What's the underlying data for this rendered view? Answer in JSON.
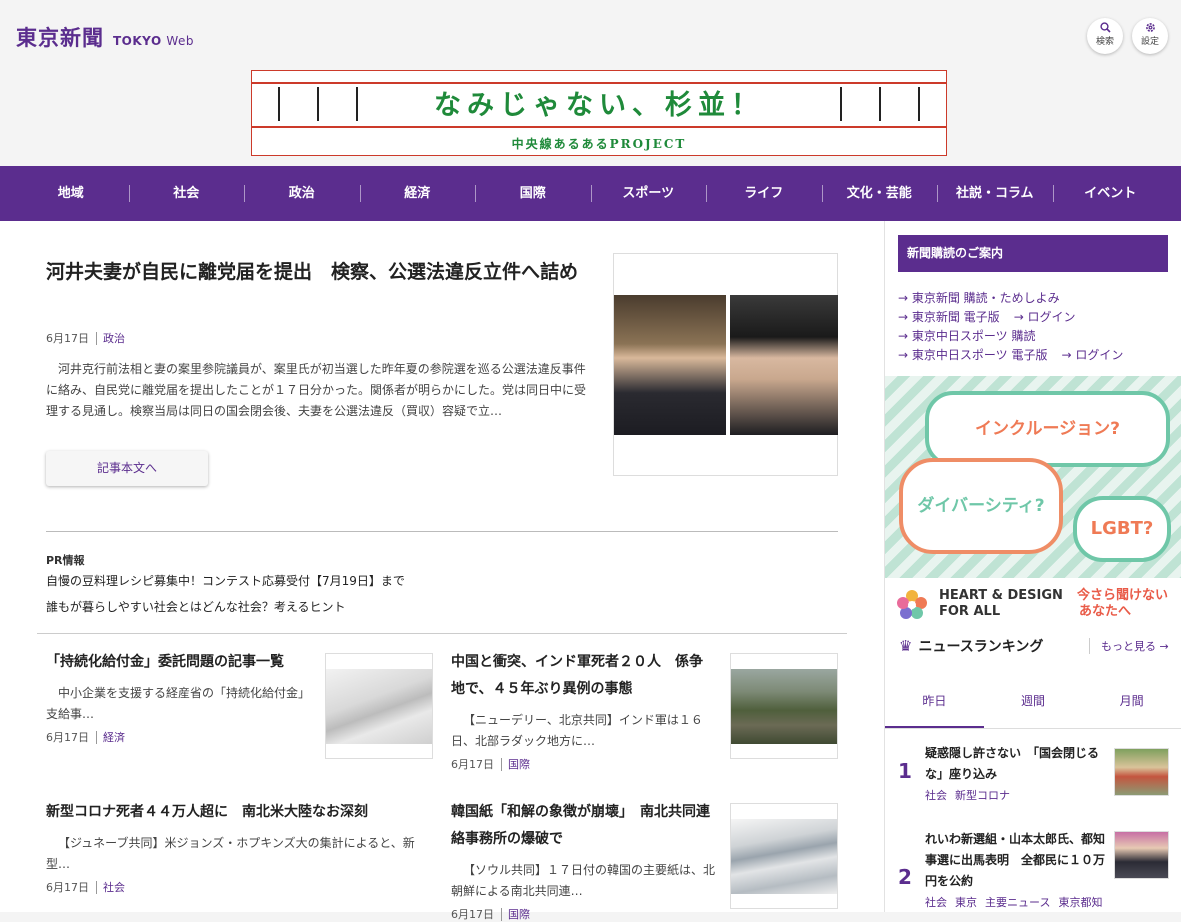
{
  "header": {
    "logo_jp": "東京新聞",
    "logo_en_bold": "TOKYO",
    "logo_en": "Web",
    "search_label": "検索",
    "settings_label": "設定"
  },
  "banner": {
    "title": "なみじゃない、杉並！",
    "subtitle": "中央線あるあるPROJECT"
  },
  "nav": [
    "地域",
    "社会",
    "政治",
    "経済",
    "国際",
    "スポーツ",
    "ライフ",
    "文化・芸能",
    "社説・コラム",
    "イベント"
  ],
  "lead": {
    "title": "河井夫妻が自民に離党届を提出　検察、公選法違反立件へ詰め",
    "date": "6月17日",
    "category": "政治",
    "body": "河井克行前法相と妻の案里参院議員が、案里氏が初当選した昨年夏の参院選を巡る公選法違反事件に絡み、自民党に離党届を提出したことが１７日分かった。関係者が明らかにした。党は同日中に受理する見通し。検察当局は同日の国会閉会後、夫妻を公選法違反（買収）容疑で立…",
    "button": "記事本文へ"
  },
  "pr": {
    "heading": "PR情報",
    "links": [
      "自慢の豆料理レシピ募集中！コンテスト応募受付【7月19日】まで",
      "誰もが暮らしやすい社会とはどんな社会？考えるヒント"
    ]
  },
  "cards": [
    {
      "title": "「持続化給付金」委託問題の記事一覧",
      "body": "中小企業を支援する経産省の「持続化給付金」支給事…",
      "date": "6月17日",
      "category": "経済"
    },
    {
      "title": "中国と衝突、インド軍死者２０人　係争地で、４５年ぶり異例の事態",
      "body": "【ニューデリー、北京共同】インド軍は１６日、北部ラダック地方に…",
      "date": "6月17日",
      "category": "国際"
    },
    {
      "title": "新型コロナ死者４４万人超に　南北米大陸なお深刻",
      "body": "【ジュネーブ共同】米ジョンズ・ホプキンズ大の集計によると、新型…",
      "date": "6月17日",
      "category": "社会"
    },
    {
      "title": "韓国紙「和解の象徴が崩壊」　南北共同連絡事務所の爆破で",
      "body": "【ソウル共同】１７日付の韓国の主要紙は、北朝鮮による南北共同連…",
      "date": "6月17日",
      "category": "国際"
    }
  ],
  "sidebar": {
    "subscribe_heading": "新聞購読のご案内",
    "subscribe_links": [
      [
        "→ 東京新聞 購読・ためしよみ"
      ],
      [
        "→ 東京新聞 電子版",
        "→ ログイン"
      ],
      [
        "→ 東京中日スポーツ 購読"
      ],
      [
        "→ 東京中日スポーツ 電子版",
        "→ ログイン"
      ]
    ],
    "ad": {
      "bubble1": "インクルージョン?",
      "bubble2": "ダイバーシティ?",
      "bubble3": "LGBT?",
      "brand_line1": "HEART & DESIGN",
      "brand_line2": "FOR ALL",
      "tagline_line1": "今さら聞けない",
      "tagline_line2": "あなたへ"
    },
    "ranking": {
      "heading": "ニュースランキング",
      "more": "もっと見る →",
      "tabs": [
        "昨日",
        "週間",
        "月間"
      ],
      "items": [
        {
          "rank": "1",
          "title": "疑惑隠し許さない　「国会閉じるな」座り込み",
          "tags": [
            "社会",
            "新型コロナ"
          ]
        },
        {
          "rank": "2",
          "title": "れいわ新選組・山本太郎氏、都知事選に出馬表明　全都民に１０万円を公約",
          "tags": [
            "社会",
            "東京",
            "主要ニュース",
            "東京都知"
          ]
        }
      ]
    }
  },
  "colors": {
    "brand_purple": "#5b2d8e",
    "banner_green": "#1f8a3a",
    "banner_red": "#cc3a2a",
    "ad_mint": "#6fc7a8",
    "ad_coral": "#ef7a55"
  }
}
